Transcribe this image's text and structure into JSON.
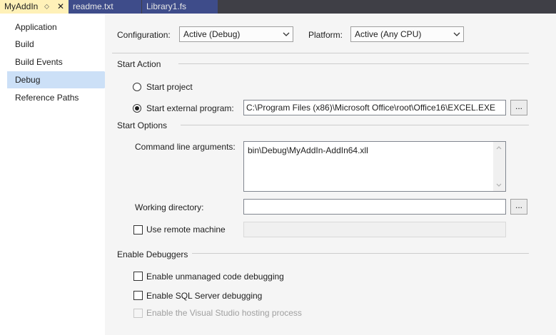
{
  "tabs": [
    {
      "label": "MyAddIn",
      "active": true
    },
    {
      "label": "readme.txt",
      "active": false
    },
    {
      "label": "Library1.fs",
      "active": false
    }
  ],
  "sidebar": {
    "items": [
      {
        "label": "Application"
      },
      {
        "label": "Build"
      },
      {
        "label": "Build Events"
      },
      {
        "label": "Debug",
        "selected": true
      },
      {
        "label": "Reference Paths"
      }
    ]
  },
  "config": {
    "configuration_label": "Configuration:",
    "configuration_value": "Active (Debug)",
    "platform_label": "Platform:",
    "platform_value": "Active (Any CPU)"
  },
  "start_action": {
    "title": "Start Action",
    "start_project_label": "Start project",
    "start_external_label": "Start external program:",
    "external_program_path": "C:\\Program Files (x86)\\Microsoft Office\\root\\Office16\\EXCEL.EXE",
    "browse_label": "...",
    "selected": "start_external"
  },
  "start_options": {
    "title": "Start Options",
    "cmd_args_label": "Command line arguments:",
    "cmd_args_value": "bin\\Debug\\MyAddIn-AddIn64.xll",
    "working_dir_label": "Working directory:",
    "working_dir_value": "",
    "browse_label": "...",
    "remote_machine_label": "Use remote machine"
  },
  "debuggers": {
    "title": "Enable Debuggers",
    "unmanaged_label": "Enable unmanaged code debugging",
    "sql_label": "Enable SQL Server debugging",
    "hosting_label": "Enable the Visual Studio hosting process"
  },
  "colors": {
    "active_tab": "#fff1b8",
    "inactive_tab": "#3e4c8a",
    "tabbar_bg": "#3f3f46",
    "selected_nav": "#cce0f7"
  }
}
